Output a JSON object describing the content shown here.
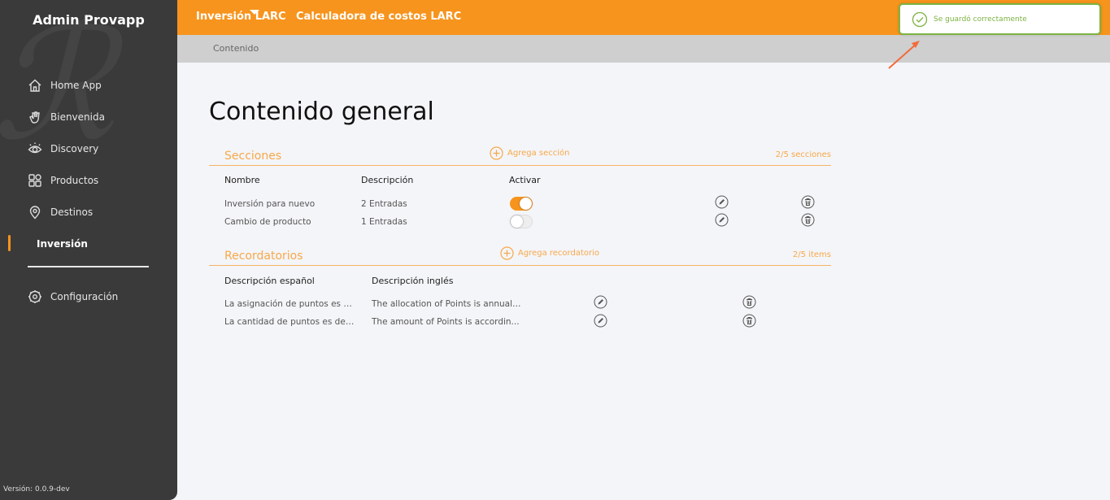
{
  "sidebar": {
    "brand": "Admin Provapp",
    "items": [
      {
        "label": "Home App",
        "icon": "home-icon"
      },
      {
        "label": "Bienvenida",
        "icon": "wave-hand-icon"
      },
      {
        "label": "Discovery",
        "icon": "eye-icon"
      },
      {
        "label": "Productos",
        "icon": "grid-icon"
      },
      {
        "label": "Destinos",
        "icon": "location-pin-icon"
      },
      {
        "label": "Inversión",
        "icon": "",
        "active": true
      }
    ],
    "config_label": "Configuración",
    "version": "Versión: 0.0.9-dev"
  },
  "topbar": {
    "tabs": [
      "Inversión LARC",
      "Calculadora de costos LARC"
    ]
  },
  "breadcrumb": "Contenido",
  "toast": {
    "message": "Se guardó correctamente",
    "color": "#7cb342"
  },
  "page_title": "Contenido general",
  "secciones": {
    "title": "Secciones",
    "add_label": "Agrega sección",
    "count": "2/5 secciones",
    "columns": [
      "Nombre",
      "Descripción",
      "Activar"
    ],
    "rows": [
      {
        "name": "Inversión para nuevo",
        "desc": "2 Entradas",
        "active": true
      },
      {
        "name": "Cambio de producto",
        "desc": "1 Entradas",
        "active": false
      }
    ]
  },
  "recordatorios": {
    "title": "Recordatorios",
    "add_label": "Agrega recordatorio",
    "count": "2/5 items",
    "columns": [
      "Descripción español",
      "Descripción inglés"
    ],
    "rows": [
      {
        "es": "La asignación de puntos es a...",
        "en": "The allocation of Points is annual ..."
      },
      {
        "es": "La cantidad de puntos es de ...",
        "en": "The amount of Points is accordin..."
      }
    ]
  },
  "colors": {
    "accent": "#f7941d",
    "sidebar": "#3a3a3a",
    "success": "#7cb342"
  }
}
